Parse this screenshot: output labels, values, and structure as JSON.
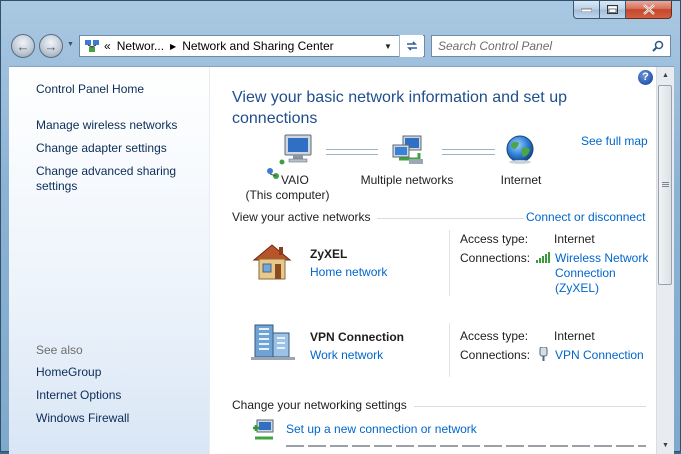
{
  "window": {
    "caption_buttons": [
      "minimize",
      "maximize",
      "close"
    ]
  },
  "address_bar": {
    "prefix": "«",
    "crumbs": [
      "Networ...",
      "Network and Sharing Center"
    ],
    "search_placeholder": "Search Control Panel"
  },
  "sidebar": {
    "home": "Control Panel Home",
    "tasks": [
      "Manage wireless networks",
      "Change adapter settings",
      "Change advanced sharing settings"
    ],
    "see_also_title": "See also",
    "see_also": [
      "HomeGroup",
      "Internet Options",
      "Windows Firewall"
    ]
  },
  "main": {
    "heading": "View your basic network information and set up connections",
    "see_full_map": "See full map",
    "map_nodes": [
      {
        "name": "VAIO",
        "sub": "(This computer)"
      },
      {
        "name": "Multiple networks"
      },
      {
        "name": "Internet"
      }
    ],
    "active_networks_title": "View your active networks",
    "connect_or_disconnect": "Connect or disconnect",
    "networks": [
      {
        "name": "ZyXEL",
        "type": "Home network",
        "access_type_label": "Access type:",
        "access_type": "Internet",
        "connections_label": "Connections:",
        "connection_lines": [
          "Wireless Network",
          "Connection",
          "(ZyXEL)"
        ]
      },
      {
        "name": "VPN Connection",
        "type": "Work network",
        "access_type_label": "Access type:",
        "access_type": "Internet",
        "connections_label": "Connections:",
        "connection": "VPN Connection"
      }
    ],
    "change_settings_title": "Change your networking settings",
    "settings_links": [
      "Set up a new connection or network"
    ]
  }
}
